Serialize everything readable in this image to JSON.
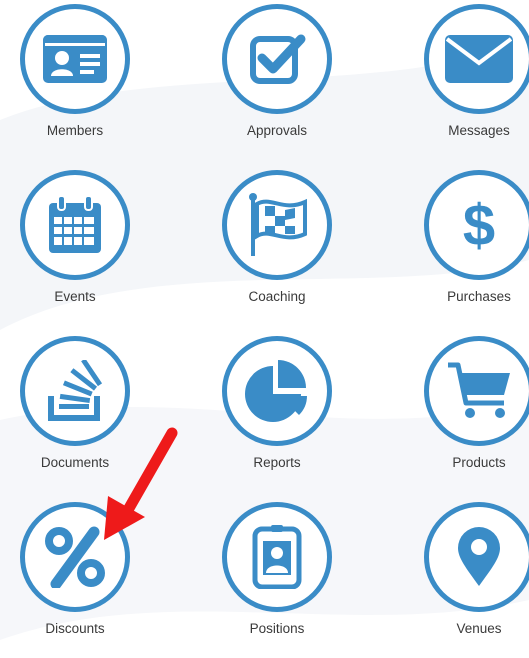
{
  "accent_color": "#3a8cc7",
  "annotation_color": "#ee1a1a",
  "tiles": [
    {
      "label": "Members",
      "icon": "id-card-icon"
    },
    {
      "label": "Approvals",
      "icon": "checkbox-icon"
    },
    {
      "label": "Messages",
      "icon": "envelope-icon"
    },
    {
      "label": "Events",
      "icon": "calendar-icon"
    },
    {
      "label": "Coaching",
      "icon": "checkered-flag-icon"
    },
    {
      "label": "Purchases",
      "icon": "dollar-icon"
    },
    {
      "label": "Documents",
      "icon": "stack-icon"
    },
    {
      "label": "Reports",
      "icon": "pie-chart-icon"
    },
    {
      "label": "Products",
      "icon": "shopping-cart-icon"
    },
    {
      "label": "Discounts",
      "icon": "percent-icon"
    },
    {
      "label": "Positions",
      "icon": "badge-icon"
    },
    {
      "label": "Venues",
      "icon": "map-pin-icon"
    }
  ],
  "annotation": {
    "icon": "red-arrow-icon",
    "target": "Discounts"
  }
}
